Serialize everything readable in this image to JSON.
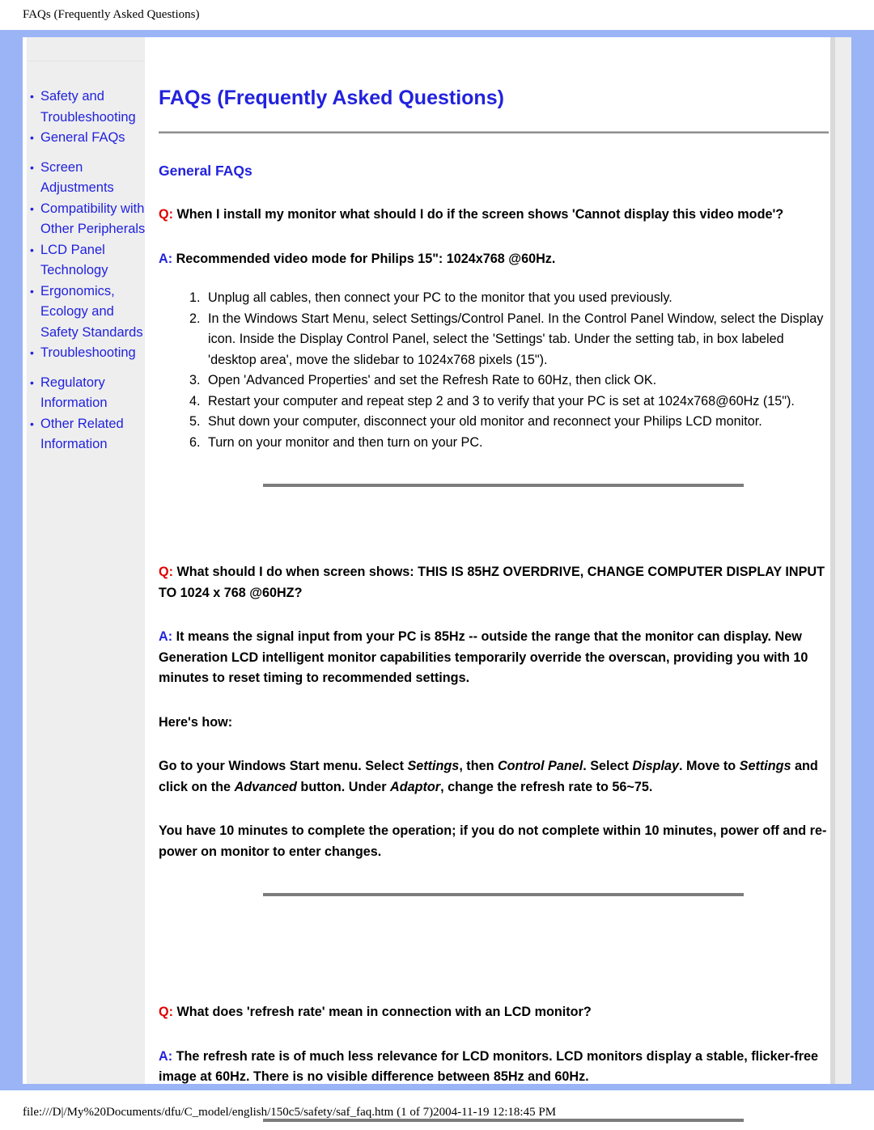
{
  "print_header": "FAQs (Frequently Asked Questions)",
  "print_footer": "file:///D|/My%20Documents/dfu/C_model/english/150c5/safety/saf_faq.htm (1 of 7)2004-11-19 12:18:45 PM",
  "colors": {
    "frame_blue": "#9ab4f5",
    "link_blue": "#2222dd",
    "q_red": "#e00000",
    "sidebar_gray": "#eeeeee",
    "rule_gray": "#7c7c7c"
  },
  "sidebar": {
    "items": [
      {
        "label": "Safety and Troubleshooting",
        "gap_after": false
      },
      {
        "label": "General FAQs",
        "gap_after": true
      },
      {
        "label": "Screen Adjustments",
        "gap_after": false
      },
      {
        "label": "Compatibility with Other Peripherals",
        "gap_after": false
      },
      {
        "label": "LCD Panel Technology",
        "gap_after": false
      },
      {
        "label": "Ergonomics, Ecology and Safety Standards",
        "gap_after": false
      },
      {
        "label": "Troubleshooting",
        "gap_after": true
      },
      {
        "label": "Regulatory Information",
        "gap_after": false
      },
      {
        "label": "Other Related Information",
        "gap_after": false
      }
    ]
  },
  "main": {
    "page_title": "FAQs (Frequently Asked Questions)",
    "section_title": "General FAQs",
    "qa": [
      {
        "q_mark": "Q:",
        "q_text": "When I install my monitor what should I do if the screen shows 'Cannot display this video mode'?",
        "a_mark": "A:",
        "a_text": "Recommended video mode for Philips 15\": 1024x768 @60Hz.",
        "steps": [
          "Unplug all cables, then connect your PC to the monitor that you used previously.",
          "In the Windows Start Menu, select Settings/Control Panel. In the Control Panel Window, select the Display icon. Inside the Display Control Panel, select the 'Settings' tab. Under the setting tab, in box labeled 'desktop area', move the slidebar to 1024x768 pixels (15\").",
          "Open 'Advanced Properties' and set the Refresh Rate to 60Hz, then click OK.",
          "Restart your computer and repeat step 2 and 3 to verify that your PC is set at 1024x768@60Hz (15\").",
          "Shut down your computer, disconnect your old monitor and reconnect your Philips LCD monitor.",
          "Turn on your monitor and then turn on your PC."
        ]
      },
      {
        "q_mark": "Q:",
        "q_text": "What should I do when screen shows: THIS IS 85HZ OVERDRIVE, CHANGE COMPUTER DISPLAY INPUT TO 1024 x 768 @60HZ?",
        "a_mark": "A:",
        "a_text": "It means the signal input from your PC is 85Hz -- outside the range that the monitor can display. New Generation LCD intelligent monitor capabilities temporarily override the overscan, providing you with 10 minutes to reset timing to recommended settings.",
        "heres_how": "Here's how:",
        "instruction_parts": [
          {
            "text": "Go to your Windows Start menu. Select ",
            "italic": false
          },
          {
            "text": "Settings",
            "italic": true
          },
          {
            "text": ", then ",
            "italic": false
          },
          {
            "text": "Control Panel",
            "italic": true
          },
          {
            "text": ". Select ",
            "italic": false
          },
          {
            "text": "Display",
            "italic": true
          },
          {
            "text": ". Move to ",
            "italic": false
          },
          {
            "text": "Settings",
            "italic": true
          },
          {
            "text": " and click on the ",
            "italic": false
          },
          {
            "text": "Advanced",
            "italic": true
          },
          {
            "text": " button. Under ",
            "italic": false
          },
          {
            "text": "Adaptor",
            "italic": true
          },
          {
            "text": ", change the refresh rate to 56~75.",
            "italic": false
          }
        ],
        "closing_text": "You have 10 minutes to complete the operation; if you do not complete within 10 minutes, power off and re-power on monitor to enter changes."
      },
      {
        "q_mark": "Q:",
        "q_text": "What does 'refresh rate' mean in connection with an LCD monitor?",
        "a_mark": "A:",
        "a_text": "The refresh rate is of much less relevance for LCD monitors. LCD monitors display a stable, flicker-free image at 60Hz. There is no visible difference between 85Hz and 60Hz."
      }
    ]
  }
}
